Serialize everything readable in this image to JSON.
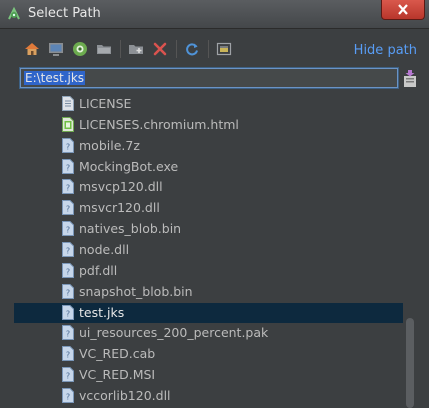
{
  "window": {
    "title": "Select Path"
  },
  "toolbar": {
    "icons": [
      "home-icon",
      "desktop-icon",
      "project-icon",
      "folder-icon",
      "new-folder-icon",
      "delete-icon",
      "refresh-icon",
      "show-hidden-icon"
    ],
    "hide_path_label": "Hide path"
  },
  "path_field": {
    "value": "E:\\test.jks"
  },
  "files": {
    "items": [
      {
        "name": "LICENSE",
        "icon": "text-file-icon"
      },
      {
        "name": "LICENSES.chromium.html",
        "icon": "html-file-icon"
      },
      {
        "name": "mobile.7z",
        "icon": "unknown-file-icon"
      },
      {
        "name": "MockingBot.exe",
        "icon": "unknown-file-icon"
      },
      {
        "name": "msvcp120.dll",
        "icon": "unknown-file-icon"
      },
      {
        "name": "msvcr120.dll",
        "icon": "unknown-file-icon"
      },
      {
        "name": "natives_blob.bin",
        "icon": "unknown-file-icon"
      },
      {
        "name": "node.dll",
        "icon": "unknown-file-icon"
      },
      {
        "name": "pdf.dll",
        "icon": "unknown-file-icon"
      },
      {
        "name": "snapshot_blob.bin",
        "icon": "unknown-file-icon"
      },
      {
        "name": "test.jks",
        "icon": "unknown-file-icon",
        "selected": true
      },
      {
        "name": "ui_resources_200_percent.pak",
        "icon": "unknown-file-icon"
      },
      {
        "name": "VC_RED.cab",
        "icon": "unknown-file-icon"
      },
      {
        "name": "VC_RED.MSI",
        "icon": "unknown-file-icon"
      },
      {
        "name": "vccorlib120.dll",
        "icon": "unknown-file-icon"
      }
    ]
  },
  "colors": {
    "background": "#3c3f41",
    "accent_link": "#589df6",
    "selection": "#0d293e"
  }
}
